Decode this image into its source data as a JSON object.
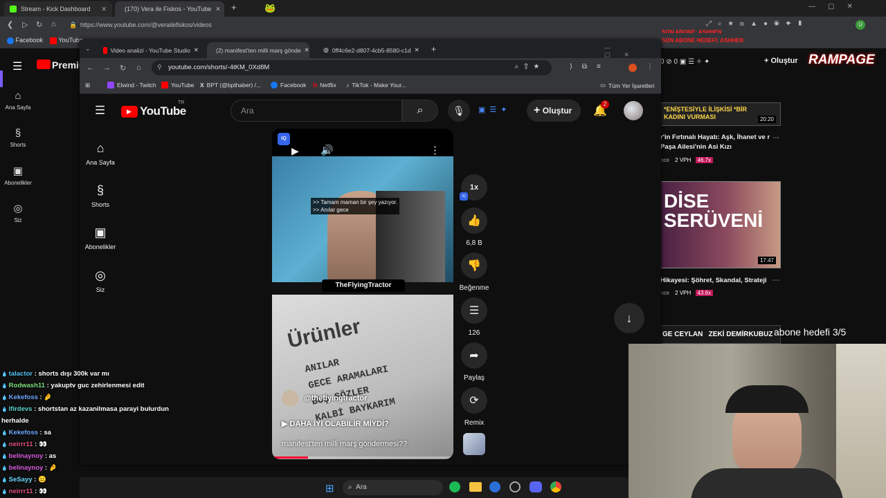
{
  "outer_browser": {
    "tabs": [
      {
        "label": "Stream - Kick Dashboard",
        "active": false
      },
      {
        "label": "(170) Vera ile Fiskos - YouTube",
        "active": true
      }
    ],
    "url": "https://www.youtube.com/@verailefiskos/videos",
    "bookmarks": [
      "Facebook",
      "YouTube"
    ]
  },
  "overlay": {
    "banner_line1": "SON ABONE: ASHHEN",
    "banner_line2": "SON ABONE HEDEFİ: ASHHEN",
    "brand": "RAMPAGE",
    "sub_goal": "abone hedefi 3/5"
  },
  "bg_youtube": {
    "premium_label": "Premium",
    "sidebar": [
      "Ana Sayfa",
      "Shorts",
      "Abonelikler",
      "Siz"
    ],
    "header_counts": [
      "0",
      "0"
    ],
    "create_label": "Oluştur",
    "videos": [
      {
        "thumb_text": "*ENİŞTESİYLE İLİŞKİSİ *BİR KADINI VURMASI",
        "duration": "20:20",
        "title": "r'in Fırtınalı Hayatı: Aşk, İhanet ve r Paşa Ailesi'nin Asi Kızı",
        "meta": "nce",
        "vph": "2 VPH",
        "mult": "46.7x"
      },
      {
        "thumb_text": "DİSE SERÜVENİ",
        "duration": "17:47",
        "title": "Hikayesi: Şöhret, Skandal, Strateji",
        "meta": "nce",
        "vph": "2 VPH",
        "mult": "43.6x"
      },
      {
        "thumb_text": "GE CEYLAN   ZEKİ DEMİRKUBUZ"
      }
    ]
  },
  "inner_browser": {
    "tabs": [
      {
        "label": "Video analizi - YouTube Studio",
        "active": false
      },
      {
        "label": "(2) manifest'ten milli marş gönde",
        "active": true
      },
      {
        "label": "0ff4c6e2-d807-4cb5-8580-c1d",
        "active": false
      }
    ],
    "url": "youtube.com/shorts/-4tKM_0Xd8M",
    "bookmarks": [
      "Elwind - Twitch",
      "YouTube",
      "BPT (@bpthaber) /...",
      "Facebook",
      "Netflix",
      "TikTok - Make Your...",
      "Tüm Yer İşaretleri"
    ]
  },
  "youtube": {
    "logo_text": "YouTube",
    "country": "TR",
    "search_placeholder": "Ara",
    "create_label": "Oluştur",
    "notif_count": "2",
    "sidebar": [
      {
        "label": "Ana Sayfa",
        "icon": "home-icon"
      },
      {
        "label": "Shorts",
        "icon": "shorts-icon"
      },
      {
        "label": "Abonelikler",
        "icon": "subscriptions-icon"
      },
      {
        "label": "Siz",
        "icon": "account-icon"
      }
    ],
    "short": {
      "caption_line1": ">> Tamam maman bir şey yazıyor.",
      "caption_line2": ">> Anılar gece",
      "channel_overlay": "TheFlyingTractor",
      "paper_title": "Ürünler",
      "paper_lines": [
        "ANILAR",
        "GECE ARAMALARI",
        "BOŞ SÖZLER",
        "KALBİ BAYKARIM"
      ],
      "channel_handle": "@theflyingtractor",
      "subtitle_link": "DAHA İYİ OLABİLİR MİYDİ?",
      "title": "manifest'ten milli marş göndermesi??",
      "progress": 0.2
    },
    "actions": {
      "speed": "1x",
      "likes": "6,8 B",
      "dislike_label": "Beğenme",
      "comments": "126",
      "share_label": "Paylaş",
      "remix_label": "Remix"
    }
  },
  "chat": [
    {
      "user": "talactor",
      "msg": "shorts dışı 300k var mı",
      "color": "#53c4f5"
    },
    {
      "user": "Rodwash11",
      "msg": "yakuptv guc zehirlenmesi edit",
      "color": "#7be07b"
    },
    {
      "user": "Kekefoss",
      "msg": "🤌",
      "color": "#6fa8ff"
    },
    {
      "user": "lfirdevs",
      "msg": "shortstan az kazanilmasa parayi bulurdun",
      "color": "#5ad6c8"
    },
    {
      "user": "",
      "msg": "herhalde",
      "color": "#ffffff"
    },
    {
      "user": "Kekefoss",
      "msg": "sa",
      "color": "#6fa8ff"
    },
    {
      "user": "neirrr11",
      "msg": "👀",
      "color": "#e0507a"
    },
    {
      "user": "belinaynoy",
      "msg": "as",
      "color": "#d95de0"
    },
    {
      "user": "belinaynoy",
      "msg": "🤌",
      "color": "#d95de0"
    },
    {
      "user": "SeSayy",
      "msg": "😐",
      "color": "#6cd6ff"
    },
    {
      "user": "neirrr11",
      "msg": "👀",
      "color": "#e0507a"
    }
  ],
  "taskbar": {
    "search_placeholder": "Ara"
  }
}
